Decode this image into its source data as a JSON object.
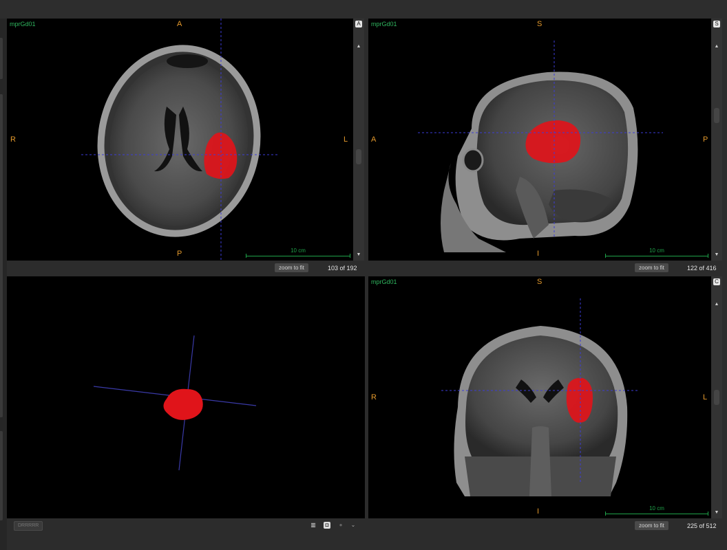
{
  "viewports": {
    "axial": {
      "series_label": "mprGd01",
      "orient": {
        "top": "A",
        "bottom": "P",
        "left": "R",
        "right": "L"
      },
      "scale_label": "10 cm",
      "zoom_label": "zoom to fit",
      "slice_indicator": "103 of 192",
      "corner_icon": "A"
    },
    "sagittal": {
      "series_label": "mprGd01",
      "orient": {
        "top": "S",
        "bottom": "I",
        "left": "A",
        "right": "P"
      },
      "scale_label": "10 cm",
      "zoom_label": "zoom to fit",
      "slice_indicator": "122 of 416",
      "corner_icon": "S"
    },
    "render3d": {
      "bottom_button": "DRRRRR"
    },
    "coronal": {
      "series_label": "mprGd01",
      "orient": {
        "top": "S",
        "bottom": "I",
        "left": "R",
        "right": "L"
      },
      "scale_label": "10 cm",
      "zoom_label": "zoom to fit",
      "slice_indicator": "225 of 512",
      "corner_icon": "C"
    }
  },
  "icons": {
    "scroll_up": "arrow-up-icon",
    "scroll_down": "arrow-down-icon",
    "layout": "layout-icon",
    "screenshot": "camera-icon",
    "visibility": "eye-icon",
    "menu": "chevron-down-icon"
  },
  "colors": {
    "tumor": "#e0141a",
    "crosshair": "#3c3cd8",
    "orientation": "#e59a2c",
    "series_label": "#2fb55e",
    "scale_bar": "#1fa34a"
  }
}
